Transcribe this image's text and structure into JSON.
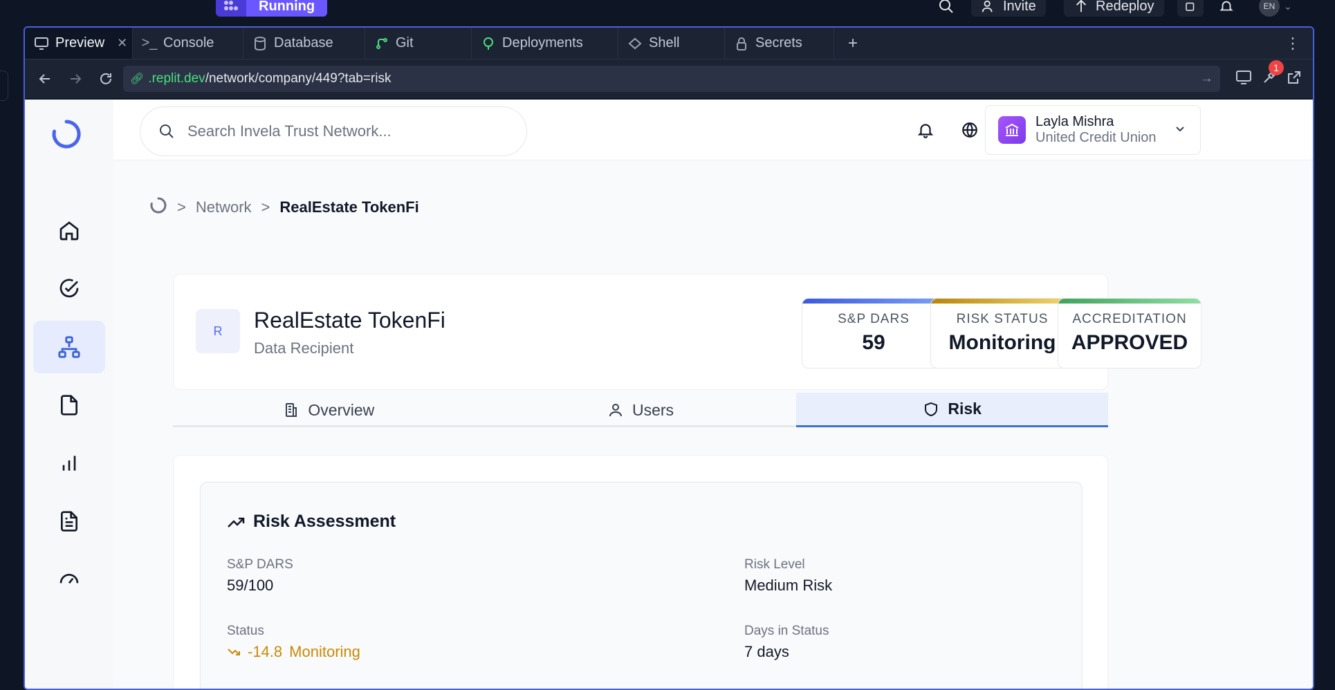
{
  "topbar": {
    "run_label": "Running",
    "invite_label": "Invite",
    "redeploy_label": "Redeploy",
    "lang": "EN"
  },
  "tabs": [
    {
      "label": "Preview",
      "icon": "monitor-icon"
    },
    {
      "label": "Console",
      "icon": "terminal-icon"
    },
    {
      "label": "Database",
      "icon": "database-icon"
    },
    {
      "label": "Git",
      "icon": "git-icon"
    },
    {
      "label": "Deployments",
      "icon": "deployments-icon"
    },
    {
      "label": "Shell",
      "icon": "shell-icon"
    },
    {
      "label": "Secrets",
      "icon": "lock-icon"
    }
  ],
  "url": {
    "host": ".replit.dev",
    "path": "/network/company/449?tab=risk",
    "notification_count": "1"
  },
  "header": {
    "search_placeholder": "Search Invela Trust Network...",
    "account_name": "Layla Mishra",
    "account_org": "United Credit Union"
  },
  "breadcrumb": {
    "level1": "Network",
    "current": "RealEstate TokenFi",
    "sep": ">"
  },
  "company": {
    "initial": "R",
    "name": "RealEstate TokenFi",
    "type": "Data Recipient",
    "stats": [
      {
        "label": "S&P DARS",
        "value": "59",
        "bar": "linear-gradient(90deg,#3b5bdb,#7aa2f7)"
      },
      {
        "label": "RISK STATUS",
        "value": "Monitoring",
        "bar": "linear-gradient(90deg,#b8860b,#f5d76e)"
      },
      {
        "label": "ACCREDITATION",
        "value": "APPROVED",
        "bar": "linear-gradient(90deg,#3fa35b,#8ee0a3)"
      }
    ]
  },
  "page_tabs": [
    {
      "label": "Overview"
    },
    {
      "label": "Users"
    },
    {
      "label": "Risk"
    }
  ],
  "risk": {
    "title": "Risk Assessment",
    "dars_label": "S&P DARS",
    "dars_value": "59/100",
    "level_label": "Risk Level",
    "level_value": "Medium Risk",
    "status_label": "Status",
    "status_change": "-14.8",
    "status_value": "Monitoring",
    "days_label": "Days in Status",
    "days_value": "7 days"
  }
}
